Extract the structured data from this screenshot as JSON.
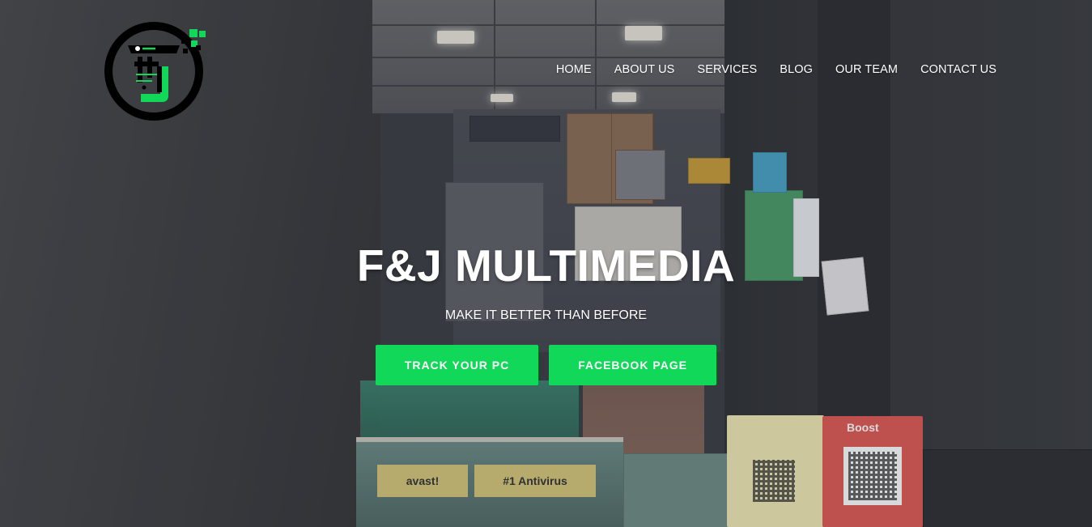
{
  "brand": {
    "logo_icon": "fj-logo-icon",
    "accent_color": "#12d85a"
  },
  "nav": {
    "items": [
      {
        "label": "HOME"
      },
      {
        "label": "ABOUT US"
      },
      {
        "label": "SERVICES"
      },
      {
        "label": "BLOG"
      },
      {
        "label": "OUR TEAM"
      },
      {
        "label": "CONTACT US"
      }
    ]
  },
  "hero": {
    "title": "F&J MULTIMEDIA",
    "subtitle": "MAKE IT BETTER THAN BEFORE",
    "buttons": {
      "track_label": "TRACK YOUR PC",
      "facebook_label": "FACEBOOK PAGE"
    },
    "button_color": "#12d85a"
  },
  "background": {
    "sticker_antivirus": "#1 Antivirus",
    "sticker_avast": "avast!",
    "card_boost": "Boost"
  }
}
